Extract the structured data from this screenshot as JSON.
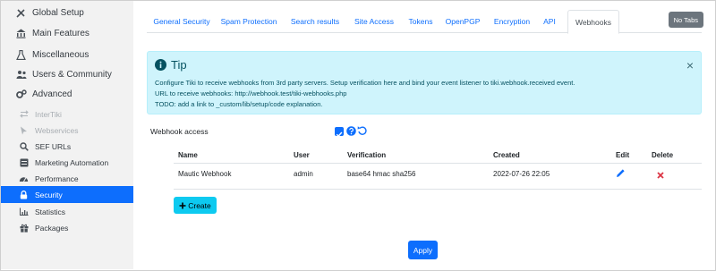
{
  "sidebar": {
    "items": [
      {
        "label": "Global Setup",
        "icon": "wrench-screwdriver-icon"
      },
      {
        "label": "Main Features",
        "icon": "bank-icon"
      },
      {
        "label": "Miscellaneous",
        "icon": "flask-icon"
      },
      {
        "label": "Users & Community",
        "icon": "users-icon"
      },
      {
        "label": "Advanced",
        "icon": "gears-icon"
      },
      {
        "label": "InterTiki",
        "icon": "exchange-icon"
      },
      {
        "label": "Webservices",
        "icon": "cursor-icon"
      },
      {
        "label": "SEF URLs",
        "icon": "search-icon"
      },
      {
        "label": "Marketing Automation",
        "icon": "server-icon"
      },
      {
        "label": "Performance",
        "icon": "tachometer-icon"
      },
      {
        "label": "Security",
        "icon": "lock-icon"
      },
      {
        "label": "Statistics",
        "icon": "chart-icon"
      },
      {
        "label": "Packages",
        "icon": "gift-icon"
      }
    ]
  },
  "tabs": [
    {
      "label": "General Security"
    },
    {
      "label": "Spam Protection"
    },
    {
      "label": "Search results"
    },
    {
      "label": "Site Access"
    },
    {
      "label": "Tokens"
    },
    {
      "label": "OpenPGP"
    },
    {
      "label": "Encryption"
    },
    {
      "label": "API"
    },
    {
      "label": "Webhooks"
    }
  ],
  "no_tabs_label": "No Tabs",
  "tip": {
    "title": "Tip",
    "lines": [
      "Configure Tiki to receive webhooks from 3rd party servers. Setup verification here and bind your event listener to tiki.webhook.received event.",
      "URL to receive webhooks: http://webhook.test/tiki-webhooks.php",
      "TODO: add a link to _custom/lib/setup/code explanation."
    ],
    "close": "×"
  },
  "webhook_access": {
    "label": "Webhook access",
    "checked": true
  },
  "table": {
    "headers": [
      "Name",
      "User",
      "Verification",
      "Created",
      "Edit",
      "Delete"
    ],
    "rows": [
      {
        "name": "Mautic Webhook",
        "user": "admin",
        "verification": "base64 hmac sha256",
        "created": "2022-07-26 22:05"
      }
    ]
  },
  "create_label": "Create",
  "apply_label": "Apply",
  "colors": {
    "primary": "#0d6efd",
    "info": "#0dcaf0",
    "tip_bg": "#cff4fc",
    "danger": "#dc3545",
    "sidebar_bg": "#f2f2f2"
  }
}
